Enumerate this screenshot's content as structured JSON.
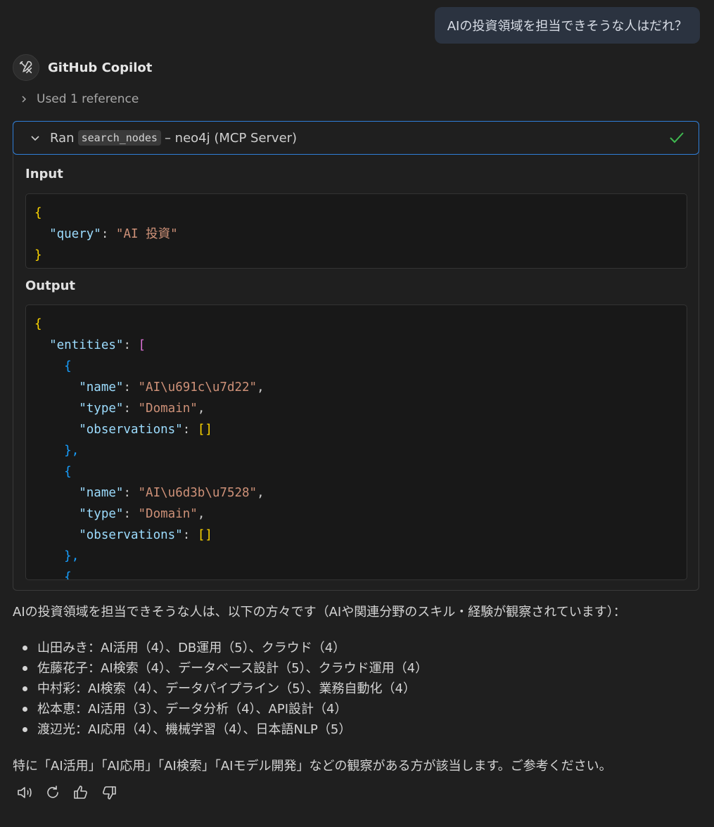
{
  "user_message": "AIの投資領域を担当できそうな人はだれ？",
  "assistant": {
    "name": "GitHub Copilot",
    "avatar_icon": "tools-icon"
  },
  "references": {
    "label": "Used 1 reference"
  },
  "tool_call": {
    "ran_label": "Ran",
    "tool_name": "search_nodes",
    "server": "– neo4j (MCP Server)",
    "status_icon": "check-icon",
    "input_label": "Input",
    "output_label": "Output"
  },
  "input_json": {
    "brace_open": "{",
    "query_key": "\"query\"",
    "query_value": "\"AI 投資\"",
    "brace_close": "}"
  },
  "output_json": {
    "brace_open": "{",
    "entities_key": "\"entities\"",
    "list_open": "[",
    "entities": [
      {
        "name": "\"AI\\u691c\\u7d22\"",
        "type": "\"Domain\""
      },
      {
        "name": "\"AI\\u6d3b\\u7528\"",
        "type": "\"Domain\""
      }
    ],
    "name_key": "\"name\"",
    "type_key": "\"type\"",
    "observations_key": "\"observations\"",
    "empty_array": "[]",
    "obj_open": "{",
    "obj_close": "},"
  },
  "answer": {
    "intro": "AIの投資領域を担当できそうな人は、以下の方々です（AIや関連分野のスキル・経験が観察されています）：",
    "people": [
      "山田みき：AI活用（4）、DB運用（5）、クラウド（4）",
      "佐藤花子：AI検索（4）、データベース設計（5）、クラウド運用（4）",
      "中村彩：AI検索（4）、データパイプライン（5）、業務自動化（4）",
      "松本恵：AI活用（3）、データ分析（4）、API設計（4）",
      "渡辺光：AI応用（4）、機械学習（4）、日本語NLP（5）"
    ],
    "outro": "特に「AI活用」「AI応用」「AI検索」「AIモデル開発」などの観察がある方が該当します。ご参考ください。"
  },
  "actions": [
    "speaker-icon",
    "retry-icon",
    "thumbs-up-icon",
    "thumbs-down-icon"
  ]
}
